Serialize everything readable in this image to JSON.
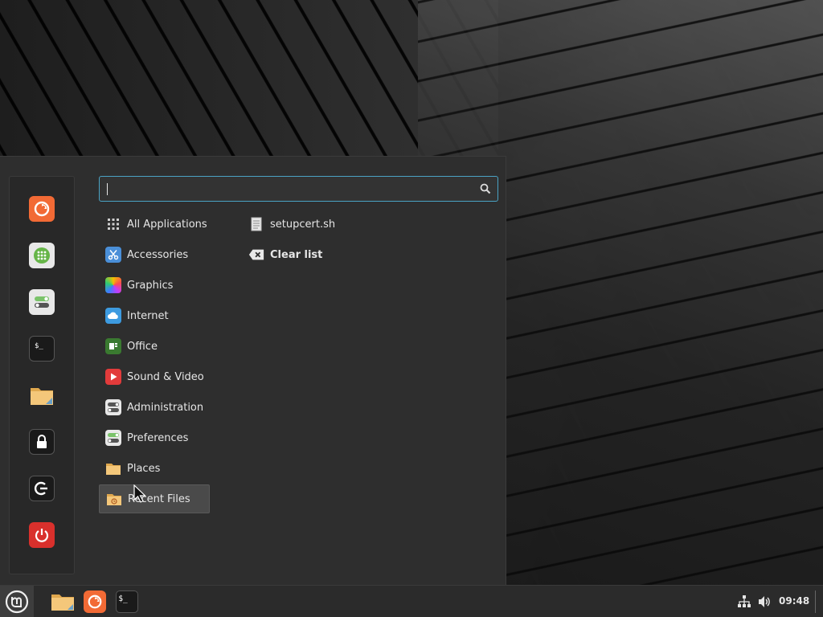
{
  "search": {
    "value": "",
    "placeholder": ""
  },
  "categories": [
    {
      "label": "All Applications",
      "icon": "grid-icon"
    },
    {
      "label": "Accessories",
      "icon": "scissors-icon"
    },
    {
      "label": "Graphics",
      "icon": "graphics-icon"
    },
    {
      "label": "Internet",
      "icon": "cloud-icon"
    },
    {
      "label": "Office",
      "icon": "office-icon"
    },
    {
      "label": "Sound & Video",
      "icon": "play-icon"
    },
    {
      "label": "Administration",
      "icon": "admin-toggle-icon"
    },
    {
      "label": "Preferences",
      "icon": "preferences-toggle-icon"
    },
    {
      "label": "Places",
      "icon": "folder-icon"
    },
    {
      "label": "Recent Files",
      "icon": "recent-folder-icon"
    }
  ],
  "recent": {
    "file": "setupcert.sh",
    "clear": "Clear list"
  },
  "favorites": [
    {
      "name": "Firefox",
      "icon": "firefox-icon"
    },
    {
      "name": "Software Manager",
      "icon": "software-manager-icon"
    },
    {
      "name": "System Settings",
      "icon": "settings-toggle-icon"
    },
    {
      "name": "Terminal",
      "icon": "terminal-icon"
    },
    {
      "name": "Files",
      "icon": "folder-icon"
    },
    {
      "name": "Lock Screen",
      "icon": "lock-icon"
    },
    {
      "name": "Log Out",
      "icon": "logout-icon"
    },
    {
      "name": "Quit",
      "icon": "power-icon"
    }
  ],
  "taskbar": {
    "clock": "09:48",
    "launchers": [
      "folder-icon",
      "firefox-icon",
      "terminal-icon"
    ]
  },
  "colors": {
    "accent": "#4aa3c4",
    "firefox": "#f26a35",
    "power": "#d9302c"
  }
}
